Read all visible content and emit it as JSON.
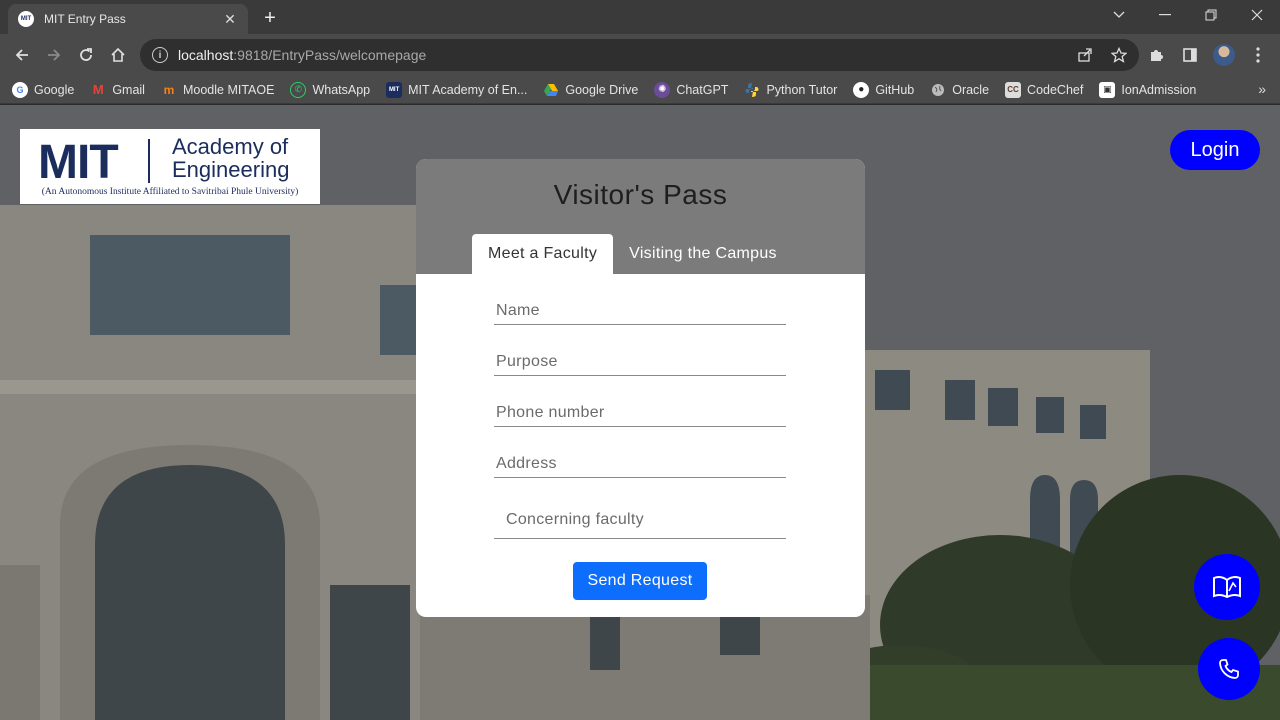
{
  "browser": {
    "tab_title": "MIT Entry Pass",
    "tab_favicon_text": "MIT",
    "url_host": "localhost",
    "url_rest": ":9818/EntryPass/welcomepage",
    "bookmarks": [
      {
        "label": "Google",
        "icon": "google-icon",
        "color": "#ffffff"
      },
      {
        "label": "Gmail",
        "icon": "gmail-icon",
        "color": "#ea4335"
      },
      {
        "label": "Moodle MITAOE",
        "icon": "moodle-icon",
        "color": "#f98012"
      },
      {
        "label": "WhatsApp",
        "icon": "whatsapp-icon",
        "color": "#25d366"
      },
      {
        "label": "MIT Academy of En...",
        "icon": "mit-icon",
        "color": "#1b2d5c"
      },
      {
        "label": "Google Drive",
        "icon": "drive-icon",
        "color": "#34a853"
      },
      {
        "label": "ChatGPT",
        "icon": "chatgpt-icon",
        "color": "#6b4c9a"
      },
      {
        "label": "Python Tutor",
        "icon": "python-icon",
        "color": "#3776ab"
      },
      {
        "label": "GitHub",
        "icon": "github-icon",
        "color": "#ffffff"
      },
      {
        "label": "Oracle",
        "icon": "globe-icon",
        "color": "#bbbbbb"
      },
      {
        "label": "CodeChef",
        "icon": "codechef-icon",
        "color": "#8b6b4a"
      },
      {
        "label": "IonAdmission",
        "icon": "ion-icon",
        "color": "#ffffff"
      }
    ]
  },
  "logo": {
    "mit": "MIT",
    "academy_line1": "Academy of",
    "academy_line2": "Engineering",
    "subtitle": "(An Autonomous Institute Affiliated to Savitribai Phule University)"
  },
  "login_label": "Login",
  "card": {
    "title": "Visitor's Pass",
    "tabs": [
      {
        "label": "Meet a Faculty",
        "active": true
      },
      {
        "label": "Visiting the Campus",
        "active": false
      }
    ],
    "fields": {
      "name": "Name",
      "purpose": "Purpose",
      "phone": "Phone number",
      "address": "Address",
      "faculty": "Concerning faculty"
    },
    "submit_label": "Send Request"
  },
  "colors": {
    "accent_blue": "#0000ff",
    "button_blue": "#0d6efd",
    "card_header": "#7b7b7b",
    "logo_navy": "#1b2d5c"
  },
  "fab_icons": [
    "book-icon",
    "phone-icon"
  ]
}
